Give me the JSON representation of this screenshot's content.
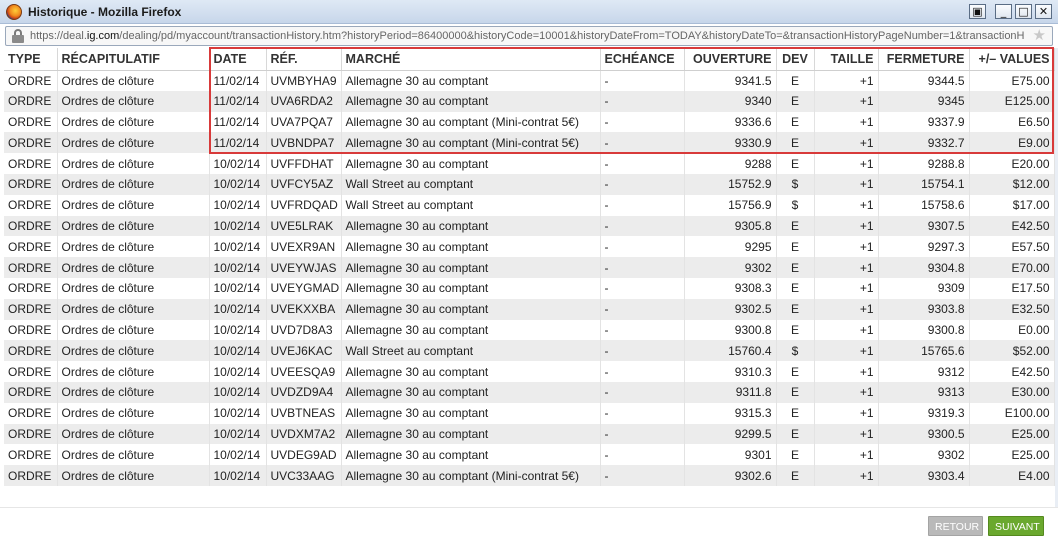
{
  "window": {
    "title": "Historique - Mozilla Firefox",
    "url_prefix": "https://deal.",
    "url_domain": "ig.com",
    "url_suffix": "/dealing/pd/myaccount/transactionHistory.htm?historyPeriod=86400000&historyCode=10001&historyDateFrom=TODAY&historyDateTo=&transactionHistoryPageNumber=1&transactionH"
  },
  "table": {
    "headers": [
      "TYPE",
      "RÉCAPITULATIF",
      "DATE",
      "RÉF.",
      "MARCHÉ",
      "ECHÉANCE",
      "OUVERTURE",
      "DEV",
      "TAILLE",
      "FERMETURE",
      "+/– VALUES"
    ],
    "rows": [
      [
        "ORDRE",
        "Ordres de clôture",
        "11/02/14",
        "UVMBYHA9",
        "Allemagne 30 au comptant",
        "-",
        "9341.5",
        "E",
        "+1",
        "9344.5",
        "E75.00"
      ],
      [
        "ORDRE",
        "Ordres de clôture",
        "11/02/14",
        "UVA6RDA2",
        "Allemagne 30 au comptant",
        "-",
        "9340",
        "E",
        "+1",
        "9345",
        "E125.00"
      ],
      [
        "ORDRE",
        "Ordres de clôture",
        "11/02/14",
        "UVA7PQA7",
        "Allemagne 30 au comptant (Mini-contrat 5€)",
        "-",
        "9336.6",
        "E",
        "+1",
        "9337.9",
        "E6.50"
      ],
      [
        "ORDRE",
        "Ordres de clôture",
        "11/02/14",
        "UVBNDPA7",
        "Allemagne 30 au comptant (Mini-contrat 5€)",
        "-",
        "9330.9",
        "E",
        "+1",
        "9332.7",
        "E9.00"
      ],
      [
        "ORDRE",
        "Ordres de clôture",
        "10/02/14",
        "UVFFDHAT",
        "Allemagne 30 au comptant",
        "-",
        "9288",
        "E",
        "+1",
        "9288.8",
        "E20.00"
      ],
      [
        "ORDRE",
        "Ordres de clôture",
        "10/02/14",
        "UVFCY5AZ",
        "Wall Street au comptant",
        "-",
        "15752.9",
        "$",
        "+1",
        "15754.1",
        "$12.00"
      ],
      [
        "ORDRE",
        "Ordres de clôture",
        "10/02/14",
        "UVFRDQAD",
        "Wall Street au comptant",
        "-",
        "15756.9",
        "$",
        "+1",
        "15758.6",
        "$17.00"
      ],
      [
        "ORDRE",
        "Ordres de clôture",
        "10/02/14",
        "UVE5LRAK",
        "Allemagne 30 au comptant",
        "-",
        "9305.8",
        "E",
        "+1",
        "9307.5",
        "E42.50"
      ],
      [
        "ORDRE",
        "Ordres de clôture",
        "10/02/14",
        "UVEXR9AN",
        "Allemagne 30 au comptant",
        "-",
        "9295",
        "E",
        "+1",
        "9297.3",
        "E57.50"
      ],
      [
        "ORDRE",
        "Ordres de clôture",
        "10/02/14",
        "UVEYWJAS",
        "Allemagne 30 au comptant",
        "-",
        "9302",
        "E",
        "+1",
        "9304.8",
        "E70.00"
      ],
      [
        "ORDRE",
        "Ordres de clôture",
        "10/02/14",
        "UVEYGMAD",
        "Allemagne 30 au comptant",
        "-",
        "9308.3",
        "E",
        "+1",
        "9309",
        "E17.50"
      ],
      [
        "ORDRE",
        "Ordres de clôture",
        "10/02/14",
        "UVEKXXBA",
        "Allemagne 30 au comptant",
        "-",
        "9302.5",
        "E",
        "+1",
        "9303.8",
        "E32.50"
      ],
      [
        "ORDRE",
        "Ordres de clôture",
        "10/02/14",
        "UVD7D8A3",
        "Allemagne 30 au comptant",
        "-",
        "9300.8",
        "E",
        "+1",
        "9300.8",
        "E0.00"
      ],
      [
        "ORDRE",
        "Ordres de clôture",
        "10/02/14",
        "UVEJ6KAC",
        "Wall Street au comptant",
        "-",
        "15760.4",
        "$",
        "+1",
        "15765.6",
        "$52.00"
      ],
      [
        "ORDRE",
        "Ordres de clôture",
        "10/02/14",
        "UVEESQA9",
        "Allemagne 30 au comptant",
        "-",
        "9310.3",
        "E",
        "+1",
        "9312",
        "E42.50"
      ],
      [
        "ORDRE",
        "Ordres de clôture",
        "10/02/14",
        "UVDZD9A4",
        "Allemagne 30 au comptant",
        "-",
        "9311.8",
        "E",
        "+1",
        "9313",
        "E30.00"
      ],
      [
        "ORDRE",
        "Ordres de clôture",
        "10/02/14",
        "UVBTNEAS",
        "Allemagne 30 au comptant",
        "-",
        "9315.3",
        "E",
        "+1",
        "9319.3",
        "E100.00"
      ],
      [
        "ORDRE",
        "Ordres de clôture",
        "10/02/14",
        "UVDXM7A2",
        "Allemagne 30 au comptant",
        "-",
        "9299.5",
        "E",
        "+1",
        "9300.5",
        "E25.00"
      ],
      [
        "ORDRE",
        "Ordres de clôture",
        "10/02/14",
        "UVDEG9AD",
        "Allemagne 30 au comptant",
        "-",
        "9301",
        "E",
        "+1",
        "9302",
        "E25.00"
      ],
      [
        "ORDRE",
        "Ordres de clôture",
        "10/02/14",
        "UVC33AAG",
        "Allemagne 30 au comptant (Mini-contrat 5€)",
        "-",
        "9302.6",
        "E",
        "+1",
        "9303.4",
        "E4.00"
      ]
    ]
  },
  "footer": {
    "retour_label": "RETOUR",
    "suivant_label": "SUIVANT"
  },
  "colors": {
    "highlight": "#d83a3a",
    "suivant": "#6aa82e",
    "retour": "#b9b9b9"
  }
}
